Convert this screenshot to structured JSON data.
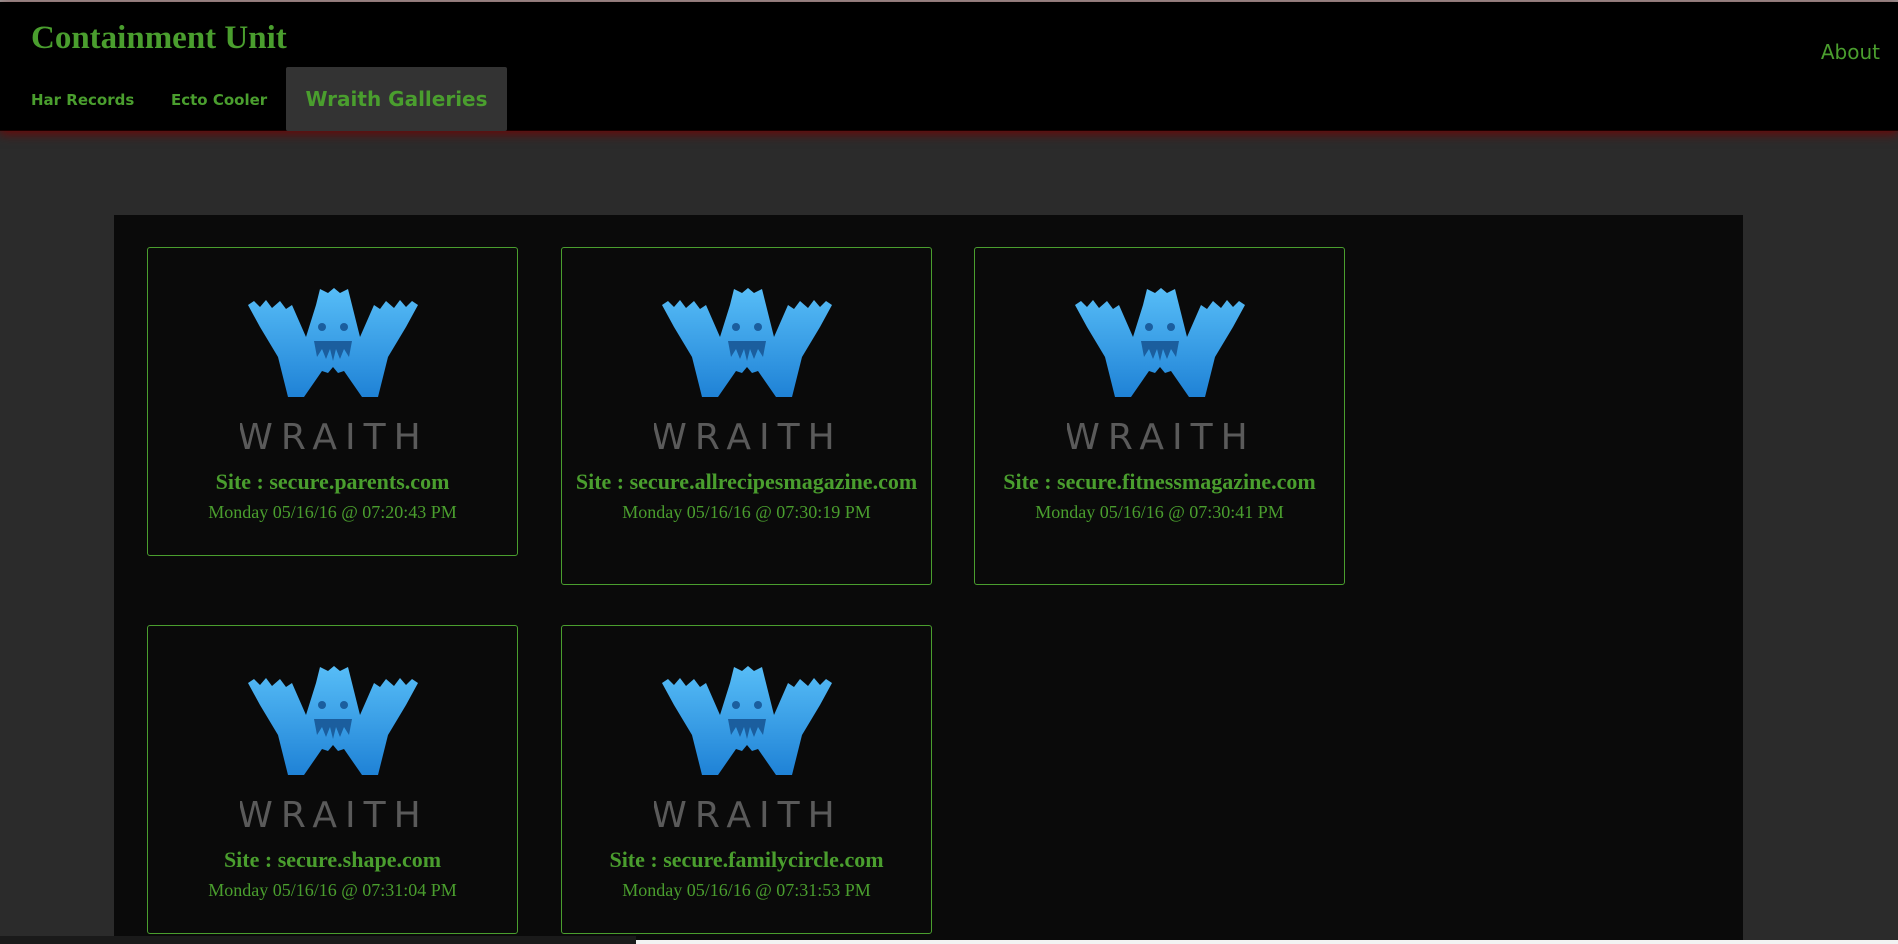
{
  "app": {
    "title": "Containment Unit",
    "about_label": "About"
  },
  "nav": {
    "tabs": [
      {
        "label": "Har Records"
      },
      {
        "label": "Ecto Cooler"
      },
      {
        "label": "Wraith Galleries"
      }
    ]
  },
  "logo": {
    "icon": "wraith-logo",
    "wordmark": "WRAITH",
    "color": "#3fa9f5"
  },
  "colors": {
    "accent": "#4a9e2e",
    "navbar": "#000000",
    "panel": "#0a0a0a",
    "page": "#2b2b2b"
  },
  "gallery": {
    "cards": [
      {
        "site": "Site : secure.parents.com",
        "date": "Monday 05/16/16 @ 07:20:43 PM"
      },
      {
        "site": "Site : secure.allrecipesmagazine.com",
        "date": "Monday 05/16/16 @ 07:30:19 PM"
      },
      {
        "site": "Site : secure.fitnessmagazine.com",
        "date": "Monday 05/16/16 @ 07:30:41 PM"
      },
      {
        "site": "Site : secure.shape.com",
        "date": "Monday 05/16/16 @ 07:31:04 PM"
      },
      {
        "site": "Site : secure.familycircle.com",
        "date": "Monday 05/16/16 @ 07:31:53 PM"
      }
    ]
  }
}
